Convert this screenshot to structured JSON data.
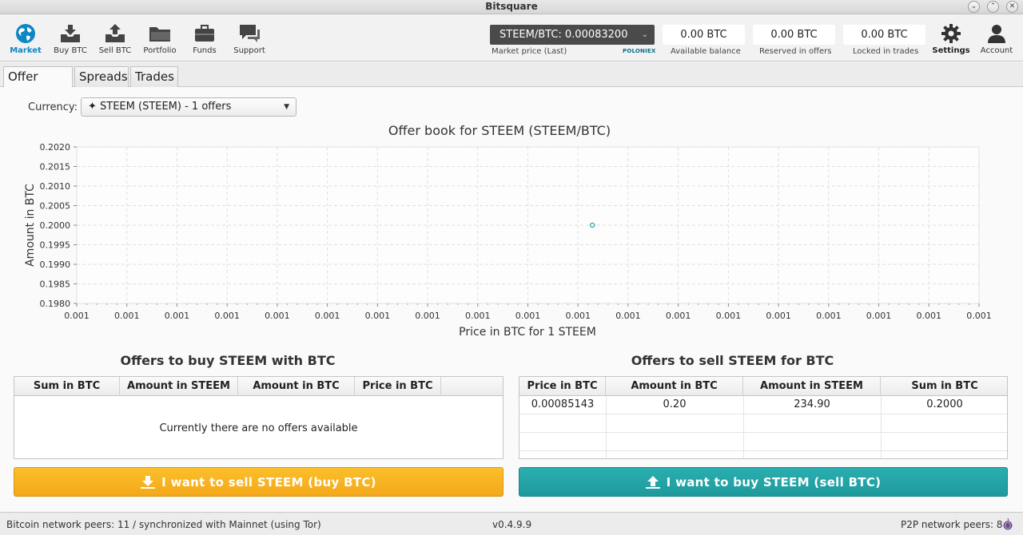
{
  "window": {
    "title": "Bitsquare"
  },
  "nav": [
    {
      "label": "Market",
      "icon": "globe-icon",
      "active": true
    },
    {
      "label": "Buy BTC",
      "icon": "download-box-icon"
    },
    {
      "label": "Sell BTC",
      "icon": "upload-box-icon"
    },
    {
      "label": "Portfolio",
      "icon": "folder-icon"
    },
    {
      "label": "Funds",
      "icon": "briefcase-icon"
    },
    {
      "label": "Support",
      "icon": "chat-bubbles-icon"
    }
  ],
  "market": {
    "selected": "STEEM/BTC: 0.00083200",
    "price_label": "Market price (Last)",
    "source": "POLONIEX"
  },
  "balances": [
    {
      "value": "0.00 BTC",
      "label": "Available balance"
    },
    {
      "value": "0.00 BTC",
      "label": "Reserved in offers"
    },
    {
      "value": "0.00 BTC",
      "label": "Locked in trades"
    }
  ],
  "right_nav": {
    "settings": "Settings",
    "account": "Account"
  },
  "tabs": [
    "Offer book",
    "Spreads",
    "Trades"
  ],
  "currency": {
    "label": "Currency:",
    "selected": "✦ STEEM (STEEM) - 1 offers"
  },
  "chart_data": {
    "type": "scatter",
    "title": "Offer book for STEEM (STEEM/BTC)",
    "xlabel": "Price in BTC for 1 STEEM",
    "ylabel": "Amount in BTC",
    "x_tick_labels": [
      "0.001",
      "0.001",
      "0.001",
      "0.001",
      "0.001",
      "0.001",
      "0.001",
      "0.001",
      "0.001",
      "0.001",
      "0.001",
      "0.001",
      "0.001",
      "0.001",
      "0.001",
      "0.001",
      "0.001",
      "0.001",
      "0.001"
    ],
    "y_ticks": [
      "0.2020",
      "0.2015",
      "0.2010",
      "0.2005",
      "0.2000",
      "0.1995",
      "0.1990",
      "0.1985",
      "0.1980"
    ],
    "ylim": [
      0.198,
      0.202
    ],
    "xlim": [
      0.0008,
      0.00089
    ],
    "grid": true,
    "points": [
      {
        "x": 0.00085143,
        "y": 0.2
      }
    ],
    "point_color": "#2aa7a9"
  },
  "buy_offers": {
    "title": "Offers to buy STEEM with BTC",
    "columns": [
      "Sum in BTC",
      "Amount in STEEM",
      "Amount in BTC",
      "Price in BTC"
    ],
    "empty_message": "Currently there are no offers available"
  },
  "sell_offers": {
    "title": "Offers to sell STEEM for BTC",
    "columns": [
      "Price in BTC",
      "Amount in BTC",
      "Amount in STEEM",
      "Sum in BTC"
    ],
    "rows": [
      [
        "0.00085143",
        "0.20",
        "234.90",
        "0.2000"
      ]
    ]
  },
  "actions": {
    "sell_label": "I want to sell STEEM (buy BTC)",
    "buy_label": "I want to buy STEEM (sell BTC)"
  },
  "footer": {
    "left": "Bitcoin network peers: 11 / synchronized with Mainnet (using Tor)",
    "center": "v0.4.9.9",
    "right": "P2P network peers: 8"
  },
  "colors": {
    "accent": "#0f87c3",
    "sell_button": "#f4a81a",
    "buy_button": "#1f9a9c"
  }
}
